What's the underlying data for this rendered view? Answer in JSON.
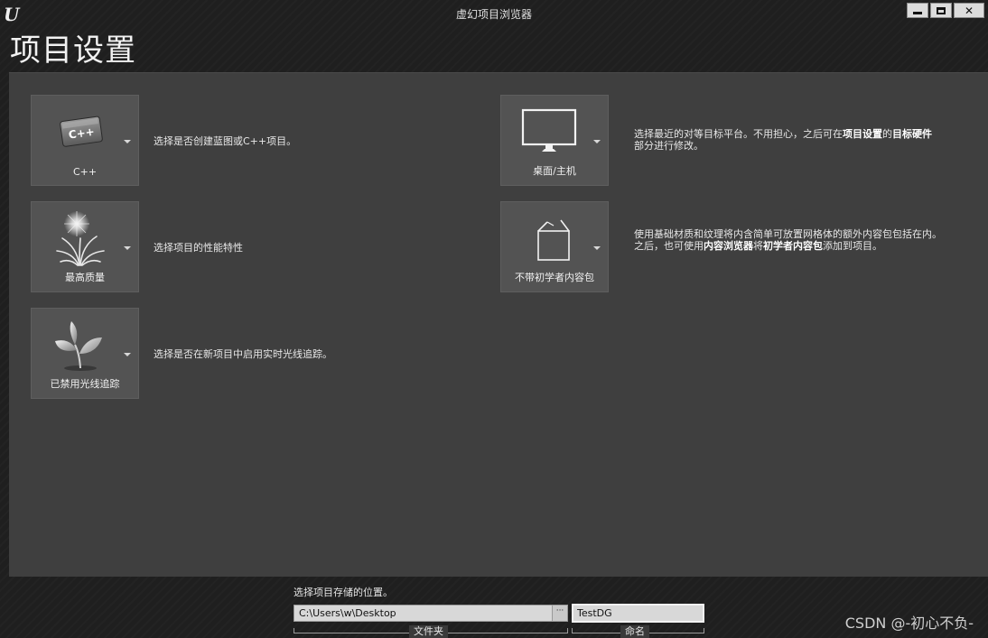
{
  "window": {
    "title": "虚幻项目浏览器",
    "logo": "U",
    "controls": {
      "minimize": "minimize-icon",
      "maximize": "maximize-icon",
      "close": "✕"
    }
  },
  "page": {
    "title": "项目设置"
  },
  "options": {
    "code": {
      "label": "C++",
      "description": "选择是否创建蓝图或C++项目。",
      "icon": "cpp-icon"
    },
    "quality": {
      "label": "最高质量",
      "description": "选择项目的性能特性",
      "icon": "sparkle-grass-icon"
    },
    "raytracing": {
      "label": "已禁用光线追踪",
      "description": "选择是否在新项目中启用实时光线追踪。",
      "icon": "plant-icon"
    },
    "platform": {
      "label": "桌面/主机",
      "description_parts": [
        "选择最近的对等目标平台。不用担心，之后可在",
        "项目设置",
        "的",
        "目标硬件",
        "部分进行修改。"
      ],
      "icon": "monitor-icon"
    },
    "starter": {
      "label": "不带初学者内容包",
      "line1": "使用基础材质和纹理将内含简单可放置网格体的额外内容包包括在内。",
      "line2_parts": [
        "之后，也可使用",
        "内容浏览器",
        "将",
        "初学者内容包",
        "添加到项目。"
      ],
      "icon": "open-box-icon"
    }
  },
  "location": {
    "prompt": "选择项目存储的位置。",
    "folder_value": "C:\\Users\\w\\Desktop",
    "browse_label": "···",
    "folder_caption": "文件夹",
    "name_value": "TestDG",
    "name_caption": "命名"
  },
  "watermark": "CSDN @-初心不负-"
}
